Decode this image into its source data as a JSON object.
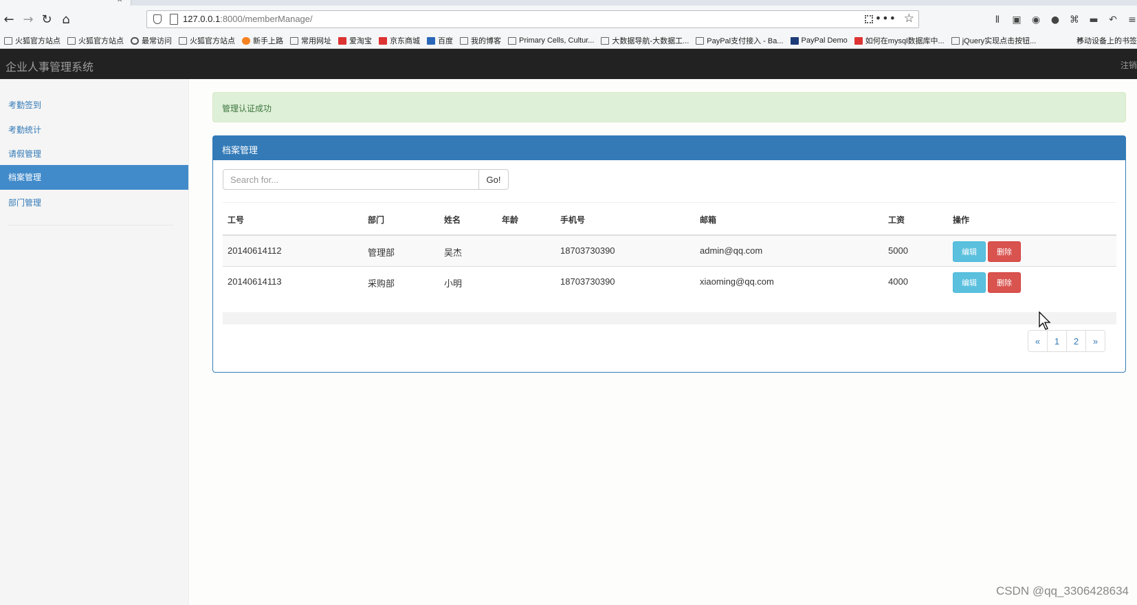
{
  "browser": {
    "url_host": "127.0.0.1",
    "url_rest": ":8000/memberManage/"
  },
  "bookmarks": [
    {
      "label": "火狐官方站点",
      "icon": "folder-icon"
    },
    {
      "label": "火狐官方站点",
      "icon": "folder-icon"
    },
    {
      "label": "最常访问",
      "icon": "gear-icon"
    },
    {
      "label": "火狐官方站点",
      "icon": "folder-icon"
    },
    {
      "label": "新手上路",
      "icon": "firefox-icon"
    },
    {
      "label": "常用网址",
      "icon": "folder-icon"
    },
    {
      "label": "爱淘宝",
      "icon": "taobao-icon"
    },
    {
      "label": "京东商城",
      "icon": "jd-icon"
    },
    {
      "label": "百度",
      "icon": "baidu-icon"
    },
    {
      "label": "我的博客",
      "icon": "blog-icon"
    },
    {
      "label": "Primary Cells, Cultur...",
      "icon": "site-icon"
    },
    {
      "label": "大数据导航-大数据工...",
      "icon": "site-icon"
    },
    {
      "label": "PayPal支付接入 - Ba...",
      "icon": "site-icon"
    },
    {
      "label": "PayPal Demo",
      "icon": "paypal-icon"
    },
    {
      "label": "如何在mysql数据库中...",
      "icon": "csdn-icon"
    },
    {
      "label": "jQuery实现点击按钮...",
      "icon": "site-icon"
    }
  ],
  "bookmarks_mobile": "移动设备上的书签",
  "app": {
    "title": "企业人事管理系统",
    "logout": "注销"
  },
  "sidebar": {
    "items": [
      {
        "label": "考勤签到"
      },
      {
        "label": "考勤统计"
      },
      {
        "label": "请假管理"
      },
      {
        "label": "档案管理"
      },
      {
        "label": "部门管理"
      }
    ]
  },
  "alert": "管理认证成功",
  "panel": {
    "title": "档案管理",
    "search_placeholder": "Search for...",
    "go_label": "Go!"
  },
  "table": {
    "headers": [
      "工号",
      "部门",
      "姓名",
      "年龄",
      "手机号",
      "邮箱",
      "工资",
      "操作"
    ],
    "rows": [
      {
        "id": "20140614112",
        "dept": "管理部",
        "name": "吴杰",
        "age": "",
        "phone": "18703730390",
        "email": "admin@qq.com",
        "salary": "5000"
      },
      {
        "id": "20140614113",
        "dept": "采购部",
        "name": "小明",
        "age": "",
        "phone": "18703730390",
        "email": "xiaoming@qq.com",
        "salary": "4000"
      }
    ],
    "edit_label": "编辑",
    "delete_label": "删除"
  },
  "pagination": [
    "«",
    "1",
    "2",
    "»"
  ],
  "watermark": "CSDN @qq_3306428634",
  "colors": {
    "navbar": "#222222",
    "primary": "#337ab7",
    "sidebar_active": "#428bca",
    "success_bg": "#dff0d8",
    "info": "#5bc0de",
    "danger": "#d9534f"
  }
}
